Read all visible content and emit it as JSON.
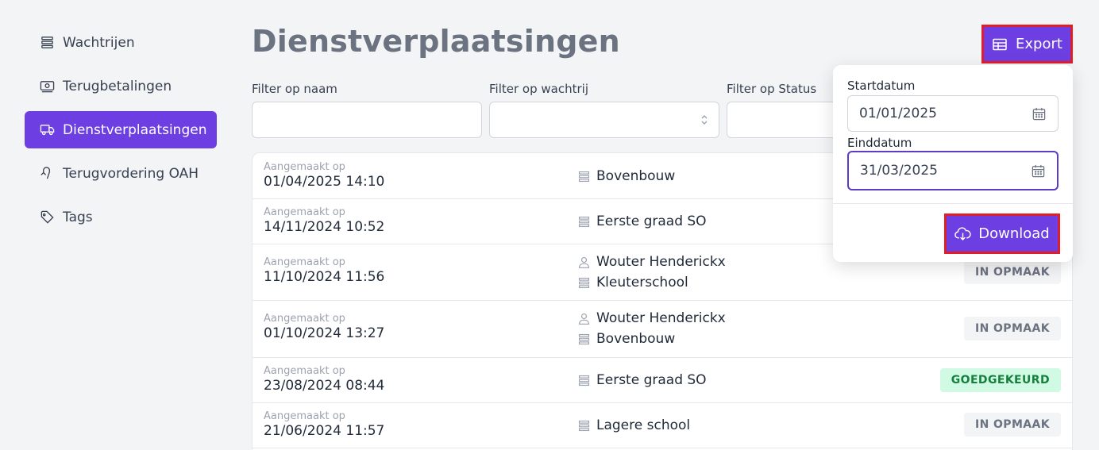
{
  "sidebar": {
    "items": [
      {
        "label": "Wachtrijen",
        "icon": "queue-icon",
        "active": false
      },
      {
        "label": "Terugbetalingen",
        "icon": "money-icon",
        "active": false
      },
      {
        "label": "Dienstverplaatsingen",
        "icon": "truck-icon",
        "active": true
      },
      {
        "label": "Terugvordering OAH",
        "icon": "return-arrow-icon",
        "active": false
      },
      {
        "label": "Tags",
        "icon": "tag-icon",
        "active": false
      }
    ]
  },
  "header": {
    "title": "Dienstverplaatsingen",
    "export_label": "Export"
  },
  "filters": {
    "name_label": "Filter op naam",
    "name_value": "",
    "queue_label": "Filter op wachtrij",
    "queue_value": "",
    "status_label": "Filter op Status",
    "status_value": ""
  },
  "table": {
    "created_label": "Aangemaakt op",
    "rows": [
      {
        "date": "01/04/2025 14:10",
        "person": "",
        "queue": "Bovenbouw",
        "status": ""
      },
      {
        "date": "14/11/2024 10:52",
        "person": "",
        "queue": "Eerste graad SO",
        "status": ""
      },
      {
        "date": "11/10/2024 11:56",
        "person": "Wouter Henderickx",
        "queue": "Kleuterschool",
        "status": "IN OPMAAK"
      },
      {
        "date": "01/10/2024 13:27",
        "person": "Wouter Henderickx",
        "queue": "Bovenbouw",
        "status": "IN OPMAAK"
      },
      {
        "date": "23/08/2024 08:44",
        "person": "",
        "queue": "Eerste graad SO",
        "status": "GOEDGEKEURD"
      },
      {
        "date": "21/06/2024 11:57",
        "person": "",
        "queue": "Lagere school",
        "status": "IN OPMAAK"
      }
    ]
  },
  "export_popup": {
    "start_label": "Startdatum",
    "start_value": "01/01/2025",
    "end_label": "Einddatum",
    "end_value": "31/03/2025",
    "download_label": "Download"
  },
  "colors": {
    "accent": "#6d3fe3",
    "highlight_border": "#e11d2a",
    "badge_gray_bg": "#f3f4f6",
    "badge_green_bg": "#d1fae5"
  }
}
